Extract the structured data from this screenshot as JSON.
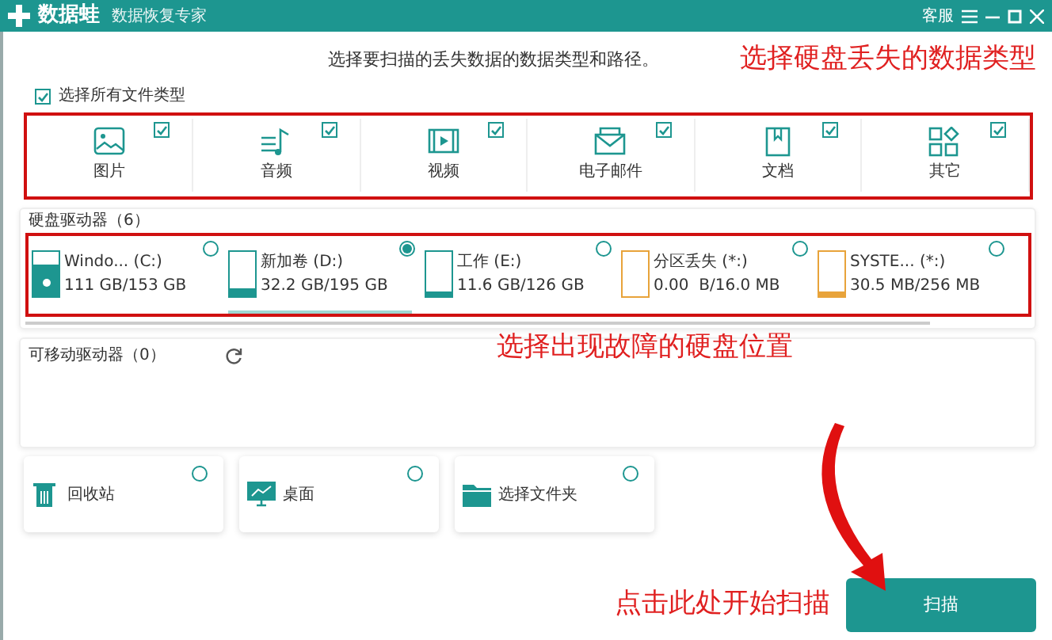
{
  "window": {
    "app_name": "数据蛙",
    "subtitle": "数据恢复专家",
    "support": "客服"
  },
  "heading": "选择要扫描的丢失数据的数据类型和路径。",
  "type_annotation": "选择硬盘丢失的数据类型",
  "select_all": {
    "label": "选择所有文件类型",
    "checked": true
  },
  "file_types": [
    {
      "kind": "image",
      "label": "图片",
      "checked": true
    },
    {
      "kind": "audio",
      "label": "音频",
      "checked": true
    },
    {
      "kind": "video",
      "label": "视频",
      "checked": true
    },
    {
      "kind": "mail",
      "label": "电子邮件",
      "checked": true
    },
    {
      "kind": "document",
      "label": "文档",
      "checked": true
    },
    {
      "kind": "other",
      "label": "其它",
      "checked": true
    }
  ],
  "hard_drives": {
    "label": "硬盘驱动器（6）",
    "drives": [
      {
        "kind": "system",
        "name": "Windo... (C:)",
        "usage": "111 GB/153 GB",
        "level": 0.73,
        "color": "#1d9690",
        "selected": false
      },
      {
        "kind": "disk",
        "name": "新加卷 (D:)",
        "usage": "32.2 GB/195 GB",
        "level": 0.17,
        "color": "#1d9690",
        "selected": true
      },
      {
        "kind": "disk",
        "name": "工作 (E:)",
        "usage": "11.6 GB/126 GB",
        "level": 0.09,
        "color": "#1d9690",
        "selected": false
      },
      {
        "kind": "disk",
        "name": "分区丢失 (*:)",
        "usage": "0.00  B/16.0 MB",
        "level": 0,
        "color": "#e8a33a",
        "selected": false
      },
      {
        "kind": "disk",
        "name": "SYSTE... (*:)",
        "usage": "30.5 MB/256 MB",
        "level": 0.12,
        "color": "#e8a33a",
        "selected": false
      }
    ]
  },
  "removable": {
    "label": "可移动驱动器（0）"
  },
  "drive_annotation": "选择出现故障的硬盘位置",
  "locations": [
    {
      "kind": "recycle",
      "label": "回收站",
      "selected": false
    },
    {
      "kind": "desktop",
      "label": "桌面",
      "selected": false
    },
    {
      "kind": "folder",
      "label": "选择文件夹",
      "selected": false
    }
  ],
  "scan_annotation": "点击此处开始扫描",
  "scan_button": "扫描"
}
